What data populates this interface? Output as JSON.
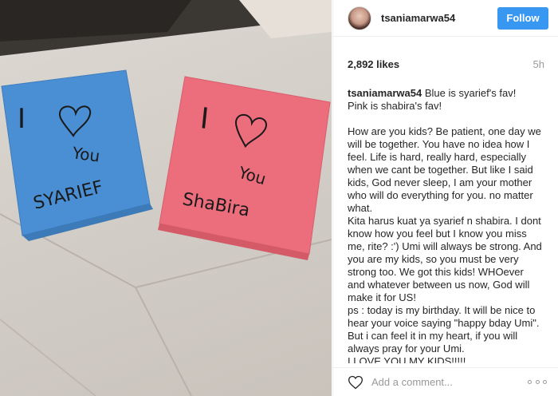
{
  "photo": {
    "blue_card": {
      "line1": "I",
      "line2": "You",
      "line3": "SYARIEF"
    },
    "pink_card": {
      "line1": "I",
      "line2": "You",
      "line3": "ShaBira"
    }
  },
  "post": {
    "username": "tsaniamarwa54",
    "follow_label": "Follow",
    "likes": "2,892 likes",
    "time": "5h",
    "caption_user": "tsaniamarwa54",
    "caption_text": " Blue is syarief's fav!\nPink is shabira's fav!\n\nHow are you kids? Be patient, one day we will be together. You have no idea how I feel. Life is hard, really hard, especially when we cant be together. But like I said kids, God never sleep, I am your mother who will do everything for you. no matter what.\nKita harus kuat ya syarief n shabira. I dont know how you feel but I know you miss me, rite? :') Umi will always be strong. And you are my kids, so you must be very strong too. We got this kids! WHOever and whatever between us now, God will make it for US!\nps : today is my birthday. It will be nice to hear your voice saying \"happy bday Umi\". But i can feel it in my heart, if you will always pray for your Umi.\nI LOVE YOU MY KIDS!!!!!",
    "comment_placeholder": "Add a comment..."
  },
  "icons": {
    "like": "heart-outline-icon",
    "more": "more-options-icon"
  },
  "colors": {
    "follow_button": "#3897f0",
    "blue_card": "#4a8fd4",
    "pink_card": "#ec6d7c"
  }
}
